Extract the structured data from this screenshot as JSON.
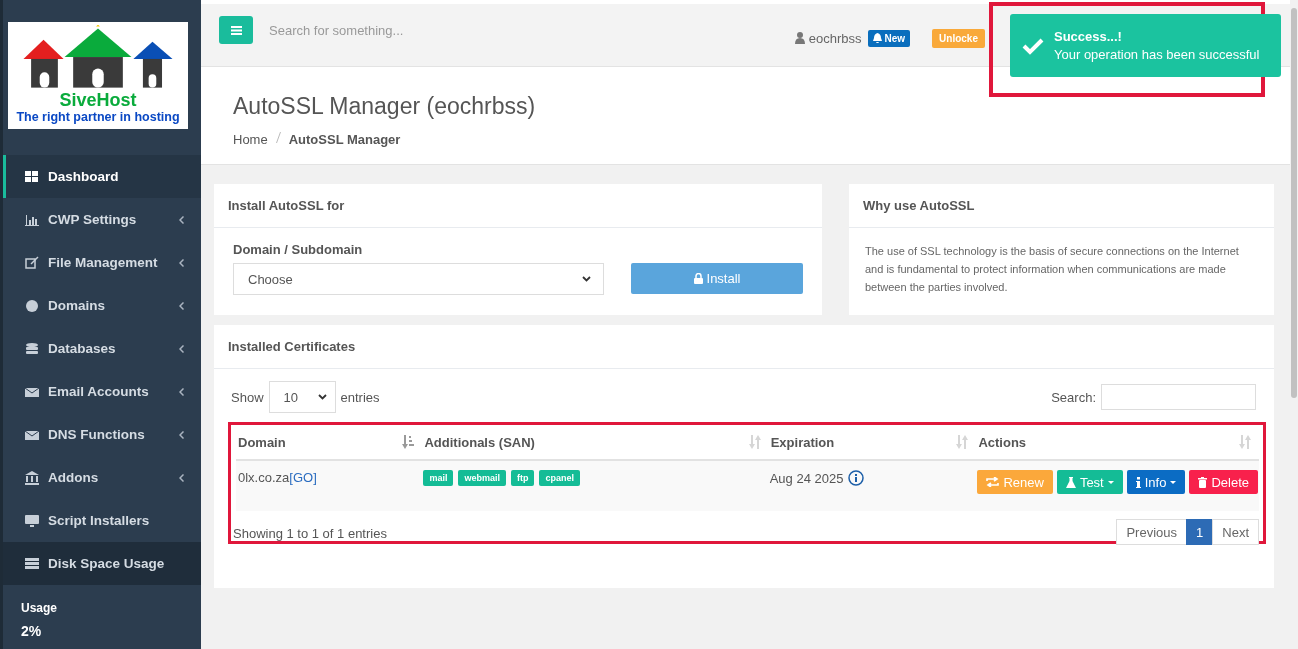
{
  "logo": {
    "name": "SiveHost",
    "tagline": "The right partner in hosting"
  },
  "topbar": {
    "search_placeholder": "Search for something...",
    "user": "eochrbss",
    "new_badge": "New",
    "lock_badge": "Unlocke"
  },
  "toast": {
    "title": "Success...!",
    "message": "Your operation has been successful",
    "highlighted": true
  },
  "sidebar": {
    "items": [
      {
        "label": "Dashboard",
        "selected": true,
        "hovered": false,
        "submenu": false
      },
      {
        "label": "CWP Settings",
        "selected": false,
        "hovered": false,
        "submenu": true
      },
      {
        "label": "File Management",
        "selected": false,
        "hovered": false,
        "submenu": true
      },
      {
        "label": "Domains",
        "selected": false,
        "hovered": false,
        "submenu": true
      },
      {
        "label": "Databases",
        "selected": false,
        "hovered": false,
        "submenu": true
      },
      {
        "label": "Email Accounts",
        "selected": false,
        "hovered": false,
        "submenu": true
      },
      {
        "label": "DNS Functions",
        "selected": false,
        "hovered": false,
        "submenu": true
      },
      {
        "label": "Addons",
        "selected": false,
        "hovered": false,
        "submenu": true
      },
      {
        "label": "Script Installers",
        "selected": false,
        "hovered": false,
        "submenu": false
      },
      {
        "label": "Disk Space Usage",
        "selected": false,
        "hovered": true,
        "submenu": false
      }
    ],
    "usage_label": "Usage",
    "usage_value": "2%"
  },
  "page": {
    "title": "AutoSSL Manager (eochrbss)",
    "breadcrumb": [
      "Home",
      "AutoSSL Manager"
    ]
  },
  "install_card": {
    "title": "Install AutoSSL for",
    "field_label": "Domain / Subdomain",
    "select_value": "Choose",
    "button": "Install"
  },
  "why_card": {
    "title": "Why use AutoSSL",
    "text": "The use of SSL technology is the basis of secure connections on the Internet and is fundamental to protect information when communications are made between the parties involved."
  },
  "certificates": {
    "title": "Installed Certificates",
    "show_label": "Show",
    "page_size": "10",
    "entries_label": "entries",
    "search_label": "Search:",
    "highlighted": true,
    "columns": [
      {
        "label": "Domain",
        "sorted": true
      },
      {
        "label": "Additionals (SAN)",
        "sorted": false
      },
      {
        "label": "Expiration",
        "sorted": false
      },
      {
        "label": "Actions",
        "sorted": false
      }
    ],
    "rows": [
      {
        "domain": "0lx.co.za",
        "link": "[GO]",
        "san": [
          "mail",
          "webmail",
          "ftp",
          "cpanel"
        ],
        "expiration": "Aug 24 2025",
        "actions": [
          {
            "label": "Renew",
            "color": "#fba83b",
            "dropdown": false
          },
          {
            "label": "Test",
            "color": "#14bc96",
            "dropdown": true
          },
          {
            "label": "Info",
            "color": "#0b6cc4",
            "dropdown": true
          },
          {
            "label": "Delete",
            "color": "#f8214c",
            "dropdown": false
          }
        ]
      }
    ],
    "summary": "Showing 1 to 1 of 1 entries",
    "pagination": [
      {
        "label": "Previous",
        "selected": false
      },
      {
        "label": "1",
        "selected": true
      },
      {
        "label": "Next",
        "selected": false
      }
    ]
  }
}
